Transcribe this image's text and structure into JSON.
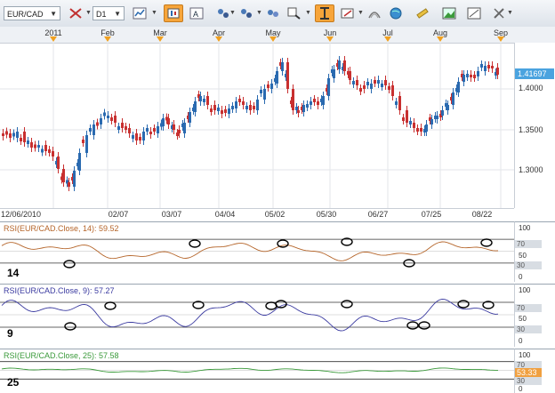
{
  "toolbar": {
    "symbol": "EUR/CAD",
    "period": "D1",
    "buttons": [
      "crosshair-tool-icon",
      "bar-chart-icon",
      "candlestick-chart-icon",
      "line-chart-icon",
      "indicators-icon",
      "studies-icon",
      "zoom-icon",
      "cursor-tool-icon",
      "draw-tool-icon",
      "fibonacci-icon",
      "globe-icon",
      "ruler-icon",
      "image-export-icon",
      "properties-icon",
      "tools-icon"
    ],
    "active_button": "cursor-tool-icon"
  },
  "months": [
    "2011",
    "Feb",
    "Mar",
    "Apr",
    "May",
    "Jun",
    "Jul",
    "Aug",
    "Sep"
  ],
  "price_axis": {
    "labels": [
      "1.4000",
      "1.3500",
      "1.3000"
    ],
    "last_price": "1.41697"
  },
  "date_axis": [
    "12/06/2010",
    "02/07",
    "03/07",
    "04/04",
    "05/02",
    "05/30",
    "06/27",
    "07/25",
    "08/22"
  ],
  "panels": [
    {
      "title": "RSI(EUR/CAD.Close, 14): 59.52",
      "period_label": "14",
      "line_color": "#b5652a",
      "scale": [
        "100",
        "70",
        "50",
        "30",
        "0"
      ],
      "last": "59.52",
      "circles": [
        [
          78,
          297
        ],
        [
          219,
          274
        ],
        [
          318,
          274
        ],
        [
          390,
          272
        ],
        [
          460,
          296
        ],
        [
          547,
          273
        ]
      ]
    },
    {
      "title": "RSI(EUR/CAD.Close, 9): 57.27",
      "period_label": "9",
      "line_color": "#3a3aa0",
      "scale": [
        "100",
        "70",
        "50",
        "30",
        "0"
      ],
      "last": "57.27",
      "circles": [
        [
          79,
          367
        ],
        [
          124,
          344
        ],
        [
          223,
          343
        ],
        [
          305,
          344
        ],
        [
          316,
          342
        ],
        [
          390,
          342
        ],
        [
          464,
          366
        ],
        [
          477,
          366
        ],
        [
          521,
          342
        ],
        [
          549,
          343
        ]
      ]
    },
    {
      "title": "RSI(EUR/CAD.Close, 25): 57.58",
      "period_label": "25",
      "line_color": "#3a9a3a",
      "scale": [
        "100",
        "70",
        "53.33",
        "30",
        "0"
      ],
      "last": "53.33",
      "circles": []
    }
  ]
}
